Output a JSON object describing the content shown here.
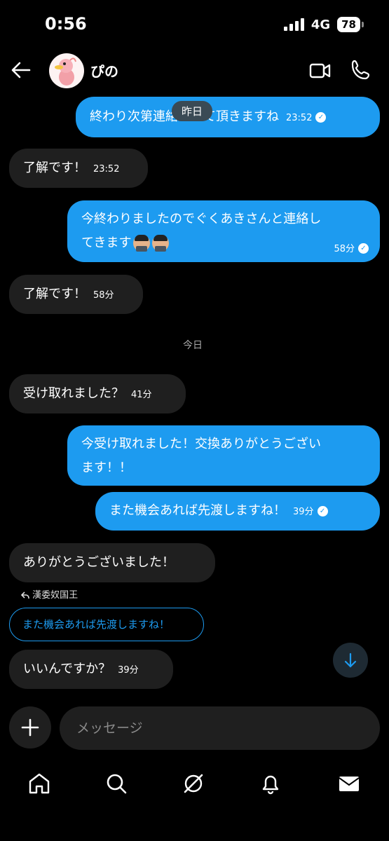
{
  "status": {
    "time": "0:56",
    "network": "4G",
    "battery": "78"
  },
  "header": {
    "contact_name": "ぴの"
  },
  "messages": {
    "m1": {
      "text": "終わり次第連絡させて頂きますね",
      "time": "23:52"
    },
    "m1_pill": "昨日",
    "m2": {
      "text": "了解です！",
      "time": "23:52"
    },
    "m3": {
      "line1": "今終わりましたのでぐくあきさんと連絡し",
      "line2": "てきます",
      "time": "58分"
    },
    "m4": {
      "text": "了解です！",
      "time": "58分"
    },
    "date_today": "今日",
    "m5": {
      "text": "受け取れました？",
      "time": "41分"
    },
    "m6": {
      "line1": "今受け取れました！交換ありがとうござい",
      "line2": "ます！！"
    },
    "m7": {
      "text": "また機会あれば先渡しますね！",
      "time": "39分"
    },
    "m8": {
      "text": "ありがとうございました！"
    },
    "reply": {
      "label": "漢委奴国王",
      "quote": "また機会あれば先渡しますね！"
    },
    "m9": {
      "text": "いいんですか？",
      "time": "39分"
    }
  },
  "composer": {
    "placeholder": "メッセージ"
  },
  "icons": {
    "back": "arrow-left-icon",
    "video": "video-camera-icon",
    "call": "phone-icon",
    "plus": "plus-icon",
    "scroll": "arrow-down-icon",
    "tabs": [
      "home-icon",
      "search-icon",
      "grok-icon",
      "bell-icon",
      "mail-icon"
    ]
  },
  "colors": {
    "accent": "#1d9bf0",
    "incoming_bubble": "#1f1f1f",
    "background": "#000000"
  }
}
